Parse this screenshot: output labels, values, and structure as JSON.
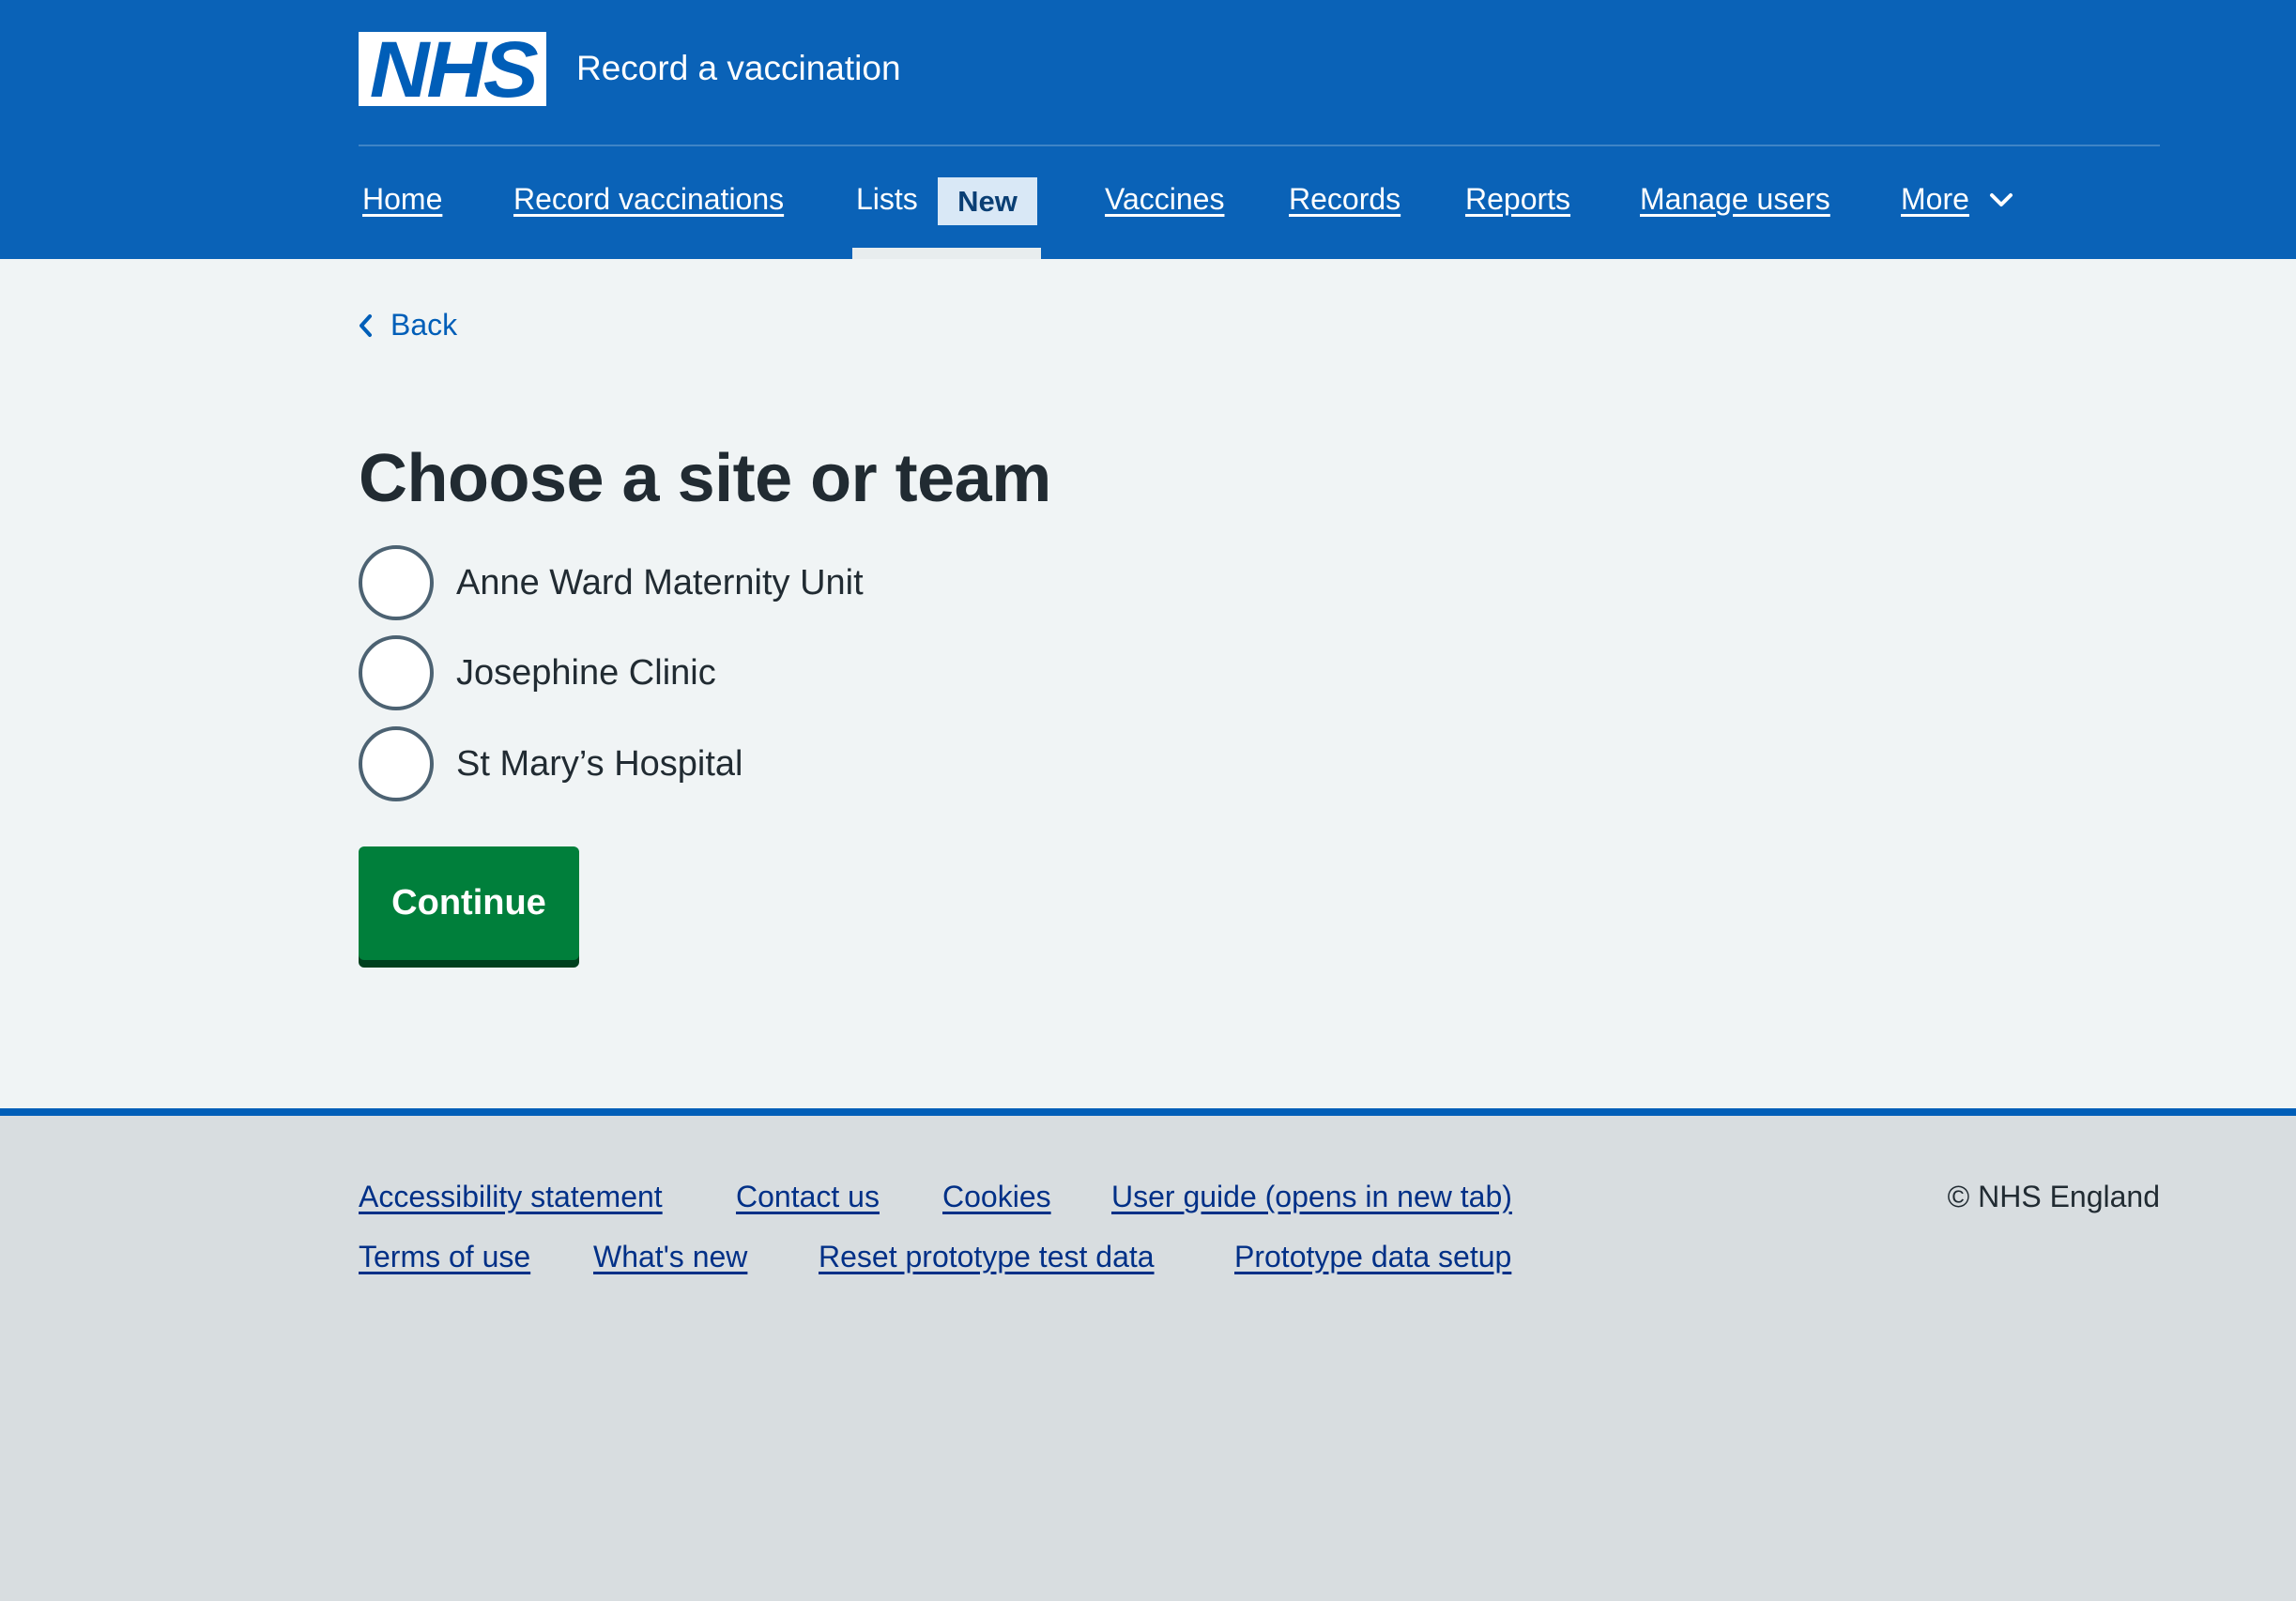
{
  "header": {
    "logo_text": "NHS",
    "service_name": "Record a vaccination",
    "nav": [
      {
        "label": "Home"
      },
      {
        "label": "Record vaccinations"
      },
      {
        "label": "Lists",
        "tag": "New"
      },
      {
        "label": "Vaccines"
      },
      {
        "label": "Records"
      },
      {
        "label": "Reports"
      },
      {
        "label": "Manage users"
      },
      {
        "label": "More"
      }
    ]
  },
  "main": {
    "back_label": "Back",
    "title": "Choose a site or team",
    "options": [
      {
        "label": "Anne Ward Maternity Unit",
        "checked": false
      },
      {
        "label": "Josephine Clinic",
        "checked": false
      },
      {
        "label": "St Mary’s Hospital",
        "checked": false
      }
    ],
    "continue_label": "Continue"
  },
  "footer": {
    "links_row1": [
      "Accessibility statement",
      "Contact us",
      "Cookies",
      "User guide (opens in new tab)"
    ],
    "links_row2": [
      "Terms of use",
      "What's new",
      "Reset prototype test data",
      "Prototype data setup"
    ],
    "copyright": "© NHS England"
  },
  "colors": {
    "header_bg": "#0a62b7",
    "main_bg": "#f0f4f5",
    "footer_bg": "#d8dde0",
    "button_green": "#007f3b",
    "link_blue": "#005eb8"
  }
}
